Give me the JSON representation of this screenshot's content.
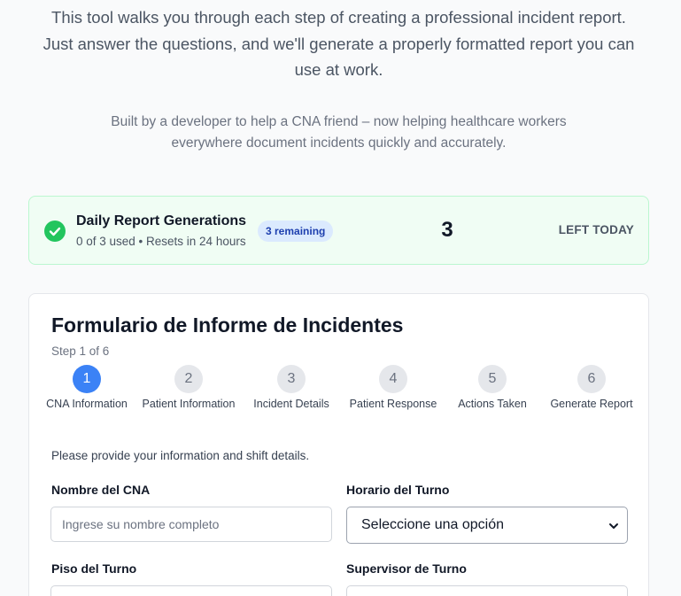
{
  "intro": {
    "description": "This tool walks you through each step of creating a professional incident report. Just answer the questions, and we'll generate a properly formatted report you can use at work.",
    "credit": "Built by a developer to help a CNA friend – now helping healthcare workers everywhere document incidents quickly and accurately."
  },
  "quota": {
    "title": "Daily Report Generations",
    "subtitle": "0 of 3 used • Resets in 24 hours",
    "badge": "3 remaining",
    "count": "3",
    "count_label": "LEFT TODAY",
    "accent_color": "#22c55e"
  },
  "form": {
    "title": "Formulario de Informe de Incidentes",
    "step_indicator": "Step 1 of 6",
    "active_step": 1,
    "steps": [
      {
        "number": "1",
        "label": "CNA Information"
      },
      {
        "number": "2",
        "label": "Patient Information"
      },
      {
        "number": "3",
        "label": "Incident Details"
      },
      {
        "number": "4",
        "label": "Patient Response"
      },
      {
        "number": "5",
        "label": "Actions Taken"
      },
      {
        "number": "6",
        "label": "Generate Report"
      }
    ],
    "instructions": "Please provide your information and shift details.",
    "fields": {
      "cna_name": {
        "label": "Nombre del CNA",
        "placeholder": "Ingrese su nombre completo",
        "value": ""
      },
      "shift_schedule": {
        "label": "Horario del Turno",
        "selected": "Seleccione una opción"
      },
      "shift_floor": {
        "label": "Piso del Turno"
      },
      "shift_supervisor": {
        "label": "Supervisor de Turno"
      }
    },
    "accent_color": "#3b82f6"
  }
}
